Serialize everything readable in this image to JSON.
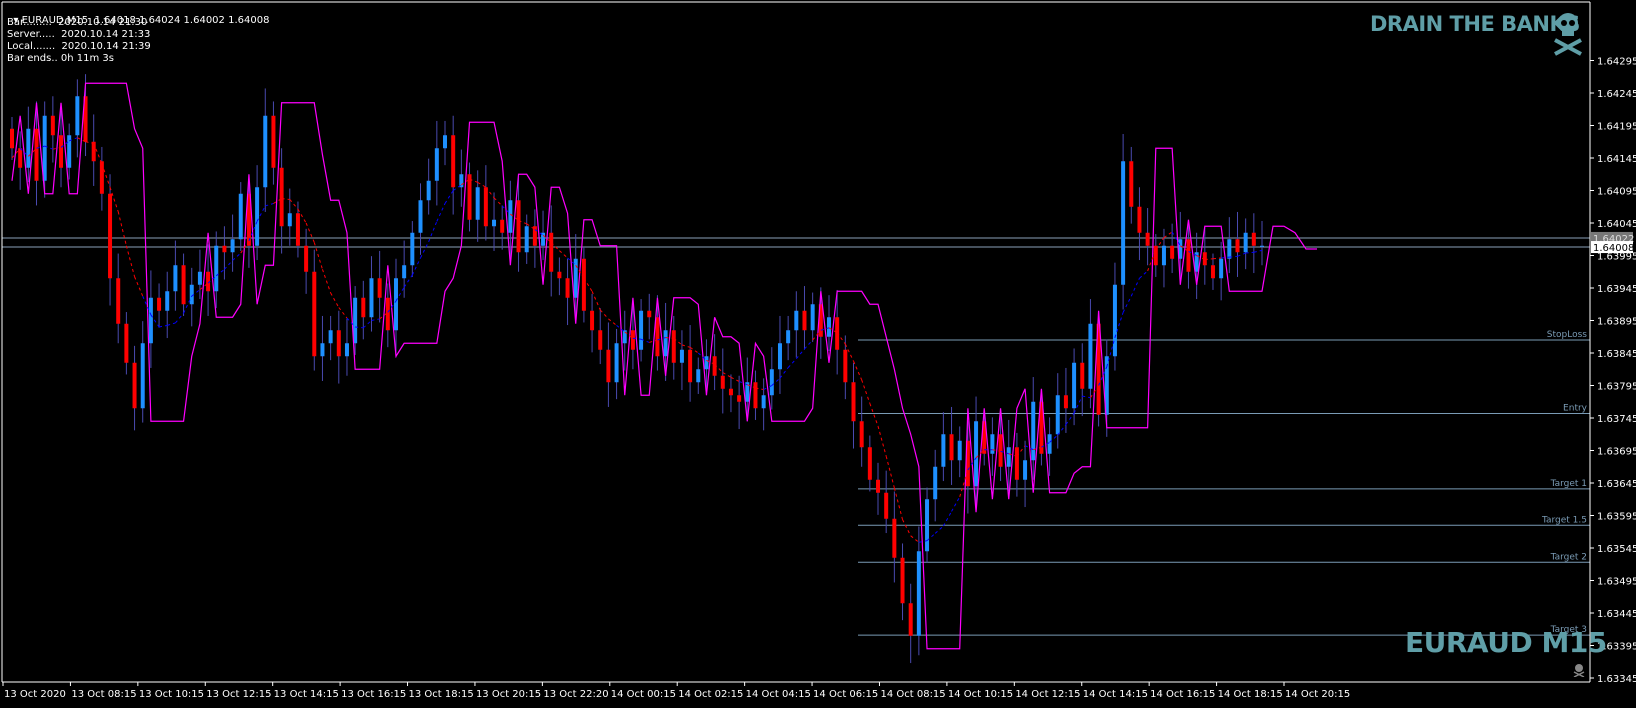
{
  "header": {
    "symbol_line": "EURAUD,M15  1.64018 1.64024 1.64002 1.64008",
    "bar_line": "Bar.........  2020.10.14 21:30",
    "server_line": "Server.....  2020.10.14 21:33",
    "local_line": "Local.......  2020.10.14 21:39",
    "bar_ends_line": "Bar ends.. 0h 11m 3s"
  },
  "brand": {
    "top_text": "DRAIN THE BANKS",
    "bottom_text": "EURAUD M15",
    "skull_icon": "skull-crossbones-icon"
  },
  "colors": {
    "background": "#000000",
    "bull": "#1e90ff",
    "bear": "#ff0000",
    "wick": "#4a4ab0",
    "channel": "#ff00ff",
    "ma_bear": "#ff0000",
    "ma_bull": "#0000ff",
    "level": "#7a9bb5",
    "axis_text": "#ffffff",
    "brand": "#5f9ea7"
  },
  "chart_data": {
    "type": "candlestick",
    "symbol": "EURAUD",
    "timeframe": "M15",
    "ylim": [
      1.63345,
      1.64345
    ],
    "y_ticks": [
      "1.64295",
      "1.64245",
      "1.64195",
      "1.64145",
      "1.64095",
      "1.64045",
      "1.63995",
      "1.63945",
      "1.63895",
      "1.63845",
      "1.63795",
      "1.63745",
      "1.63695",
      "1.63645",
      "1.63595",
      "1.63545",
      "1.63495",
      "1.63445",
      "1.63395",
      "1.63345"
    ],
    "x_labels": [
      "13 Oct 2020",
      "13 Oct 08:15",
      "13 Oct 10:15",
      "13 Oct 12:15",
      "13 Oct 14:15",
      "13 Oct 16:15",
      "13 Oct 18:15",
      "13 Oct 20:15",
      "13 Oct 22:20",
      "14 Oct 00:15",
      "14 Oct 02:15",
      "14 Oct 04:15",
      "14 Oct 06:15",
      "14 Oct 08:15",
      "14 Oct 10:15",
      "14 Oct 12:15",
      "14 Oct 14:15",
      "14 Oct 16:15",
      "14 Oct 18:15",
      "14 Oct 20:15"
    ],
    "price_labels": [
      {
        "text": "1.64022",
        "value": 1.64022,
        "style": "ask"
      },
      {
        "text": "1.64008",
        "value": 1.64008,
        "style": "bid"
      }
    ],
    "levels": [
      {
        "name": "StopLoss",
        "value": 1.63865
      },
      {
        "name": "Entry",
        "value": 1.63752
      },
      {
        "name": "Target 1",
        "value": 1.63636
      },
      {
        "name": "Target 1.5",
        "value": 1.6358
      },
      {
        "name": "Target 2",
        "value": 1.63523
      },
      {
        "name": "Target 3",
        "value": 1.63411
      }
    ],
    "closes": [
      1.6416,
      1.6413,
      1.6419,
      1.6411,
      1.6421,
      1.6418,
      1.6413,
      1.6418,
      1.6424,
      1.6417,
      1.6414,
      1.6409,
      1.6396,
      1.6389,
      1.6383,
      1.6376,
      1.6386,
      1.6393,
      1.6391,
      1.6394,
      1.6398,
      1.6392,
      1.6395,
      1.6397,
      1.6394,
      1.6401,
      1.64,
      1.6402,
      1.6409,
      1.6401,
      1.641,
      1.6421,
      1.6413,
      1.6404,
      1.6406,
      1.6401,
      1.6397,
      1.6384,
      1.6386,
      1.6388,
      1.6384,
      1.6386,
      1.6393,
      1.639,
      1.6396,
      1.6393,
      1.6388,
      1.6396,
      1.6398,
      1.6403,
      1.6408,
      1.6411,
      1.6416,
      1.6418,
      1.641,
      1.6412,
      1.6405,
      1.641,
      1.6404,
      1.6405,
      1.6403,
      1.6408,
      1.64,
      1.6404,
      1.6401,
      1.6403,
      1.6397,
      1.6396,
      1.6393,
      1.6399,
      1.6391,
      1.6388,
      1.6385,
      1.638,
      1.6386,
      1.6388,
      1.6385,
      1.6391,
      1.639,
      1.6384,
      1.6388,
      1.6383,
      1.6385,
      1.638,
      1.6382,
      1.6384,
      1.6381,
      1.6379,
      1.6378,
      1.6377,
      1.638,
      1.6376,
      1.6378,
      1.6382,
      1.6386,
      1.6388,
      1.6391,
      1.6388,
      1.6392,
      1.6387,
      1.639,
      1.6385,
      1.638,
      1.6374,
      1.637,
      1.6365,
      1.6363,
      1.6359,
      1.6353,
      1.6346,
      1.6341,
      1.6354,
      1.6362,
      1.6367,
      1.6372,
      1.6368,
      1.6371,
      1.6364,
      1.6374,
      1.6369,
      1.6372,
      1.6367,
      1.637,
      1.6365,
      1.6368,
      1.6377,
      1.6369,
      1.6372,
      1.6378,
      1.6376,
      1.6383,
      1.6379,
      1.6389,
      1.6375,
      1.6384,
      1.6395,
      1.6414,
      1.6407,
      1.6403,
      1.6401,
      1.6398,
      1.6401,
      1.6399,
      1.6402,
      1.6397,
      1.64,
      1.6398,
      1.6396,
      1.6399,
      1.6402,
      1.64,
      1.6403,
      1.6401,
      1.6401
    ]
  }
}
